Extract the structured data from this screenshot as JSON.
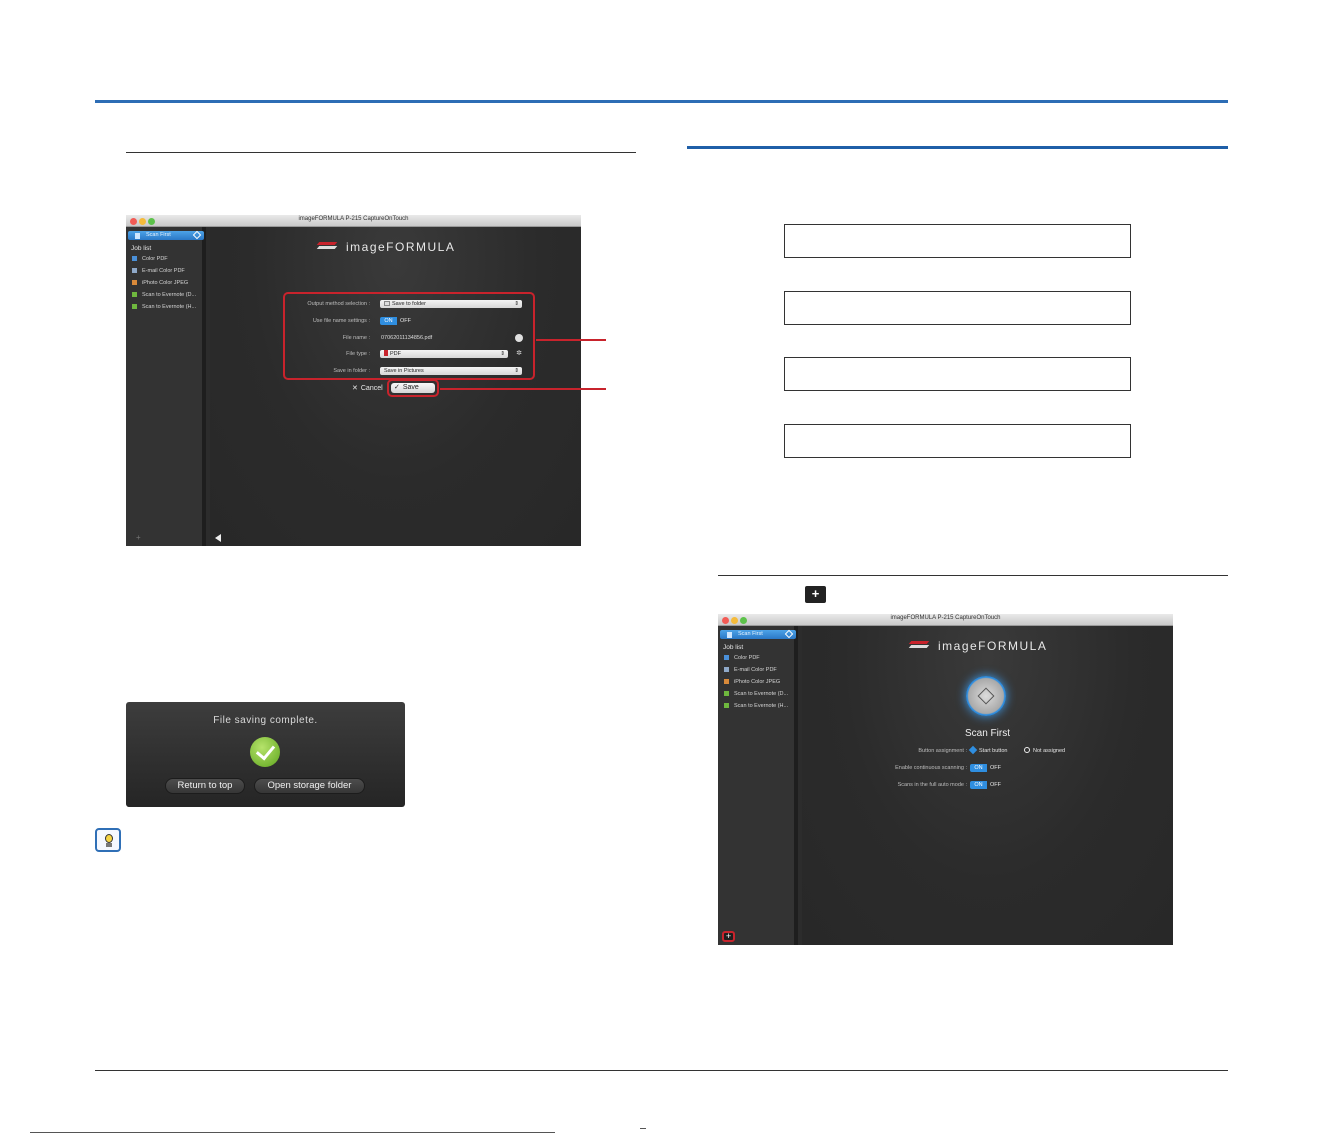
{
  "left_window": {
    "title": "imageFORMULA P-215 CaptureOnTouch",
    "sidebar": {
      "selected_job": "Scan First",
      "heading": "Job list",
      "items": [
        "Color PDF",
        "E-mail Color PDF",
        "iPhoto Color JPEG",
        "Scan to Evernote (D...",
        "Scan to Evernote (H..."
      ]
    },
    "logo": "imageFORMULA",
    "form": {
      "output_label": "Output method selection :",
      "output_value": "Save to folder",
      "use_file_name_label": "Use file name settings :",
      "toggle_on": "ON",
      "toggle_off": "OFF",
      "file_name_label": "File name :",
      "file_name_value": "07062011134856.pdf",
      "file_type_label": "File type :",
      "file_type_value": "PDF",
      "save_in_label": "Save in folder :",
      "save_in_value": "Save in Pictures"
    },
    "cancel_label": "Cancel",
    "save_label": "Save"
  },
  "dialog": {
    "message": "File saving complete.",
    "return_label": "Return to top",
    "open_label": "Open storage folder"
  },
  "right_window": {
    "title": "imageFORMULA P-215 CaptureOnTouch",
    "sidebar": {
      "selected_job": "Scan First",
      "heading": "Job list",
      "items": [
        "Color PDF",
        "E-mail Color PDF",
        "iPhoto Color JPEG",
        "Scan to Evernote (D...",
        "Scan to Evernote (H..."
      ]
    },
    "logo": "imageFORMULA",
    "job_title": "Scan First",
    "button_assignment_label": "Button assignment :",
    "start_button_label": "Start button",
    "not_assigned_label": "Not assigned",
    "continuous_label": "Enable continuous scanning :",
    "full_auto_label": "Scans in the full auto mode :",
    "toggle_on": "ON",
    "toggle_off": "OFF"
  },
  "step_plus_icon": "+"
}
